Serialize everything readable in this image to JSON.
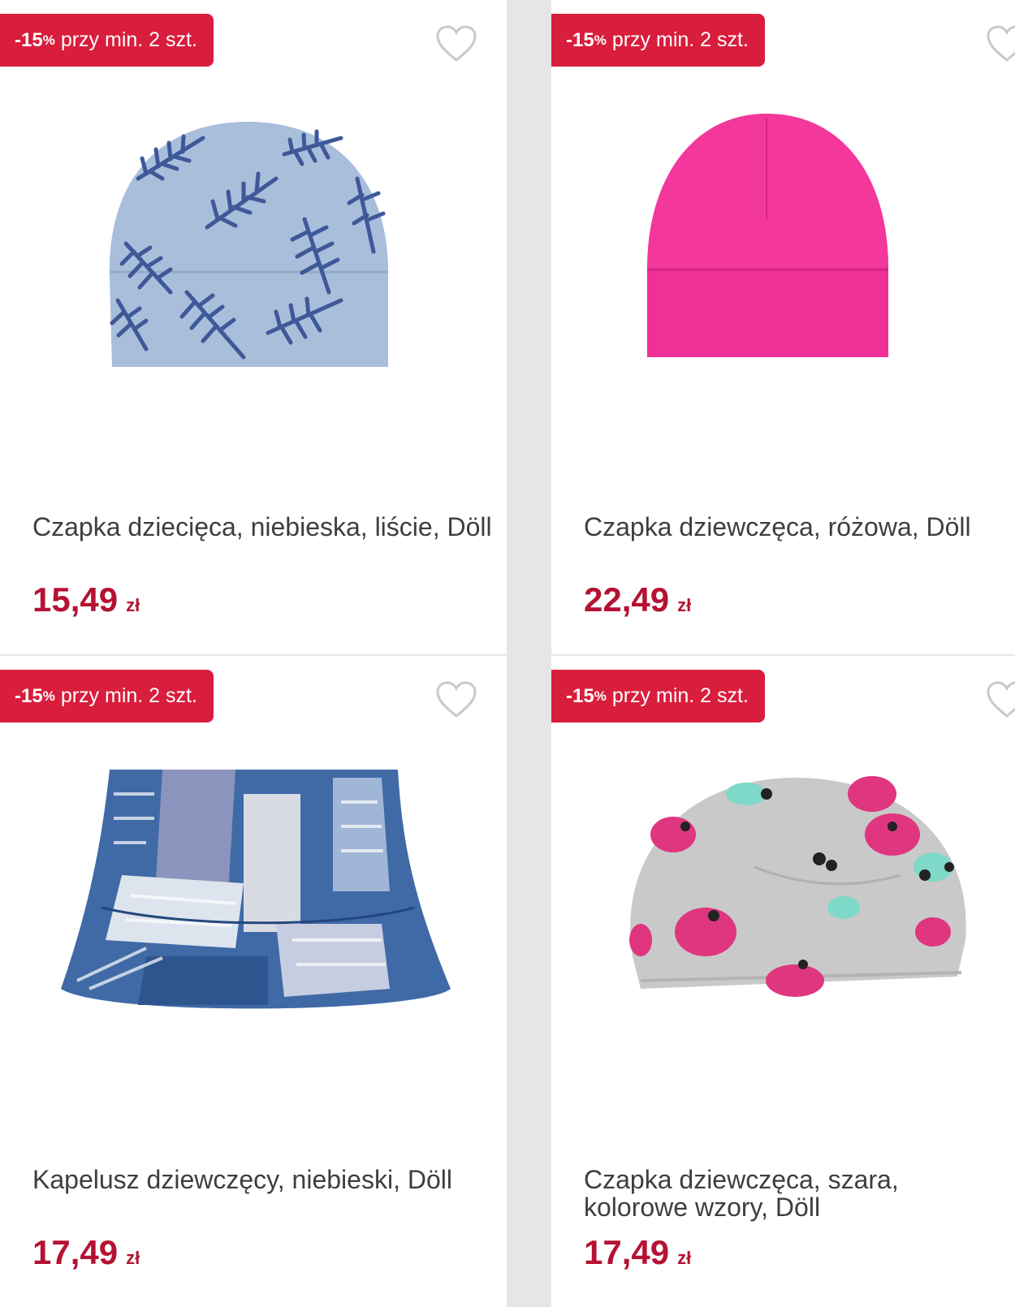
{
  "products": [
    {
      "badge": {
        "percent": "-15",
        "percent_sign": "%",
        "text": "przy min. 2 szt."
      },
      "title": "Czapka dziecięca, niebieska, liście, Döll",
      "price": "15,49",
      "currency": "zł",
      "image_icon": "blue-leaf-beanie-image"
    },
    {
      "badge": {
        "percent": "-15",
        "percent_sign": "%",
        "text": "przy min. 2 szt."
      },
      "title": "Czapka dziewczęca, różowa, Döll",
      "price": "22,49",
      "currency": "zł",
      "image_icon": "pink-beanie-image"
    },
    {
      "badge": {
        "percent": "-15",
        "percent_sign": "%",
        "text": "przy min. 2 szt."
      },
      "title": "Kapelusz dziewczęcy, niebieski, Döll",
      "price": "17,49",
      "currency": "zł",
      "image_icon": "blue-patchwork-bucket-hat-image"
    },
    {
      "badge": {
        "percent": "-15",
        "percent_sign": "%",
        "text": "przy min. 2 szt."
      },
      "title": "Czapka dziewczęca, szara, kolorowe wzory, Döll",
      "price": "17,49",
      "currency": "zł",
      "image_icon": "grey-pattern-slouchy-hat-image"
    }
  ],
  "colors": {
    "badge": "#d91d3c",
    "price": "#b51233",
    "title": "#3e3e3e",
    "background": "#e6e6e6"
  }
}
